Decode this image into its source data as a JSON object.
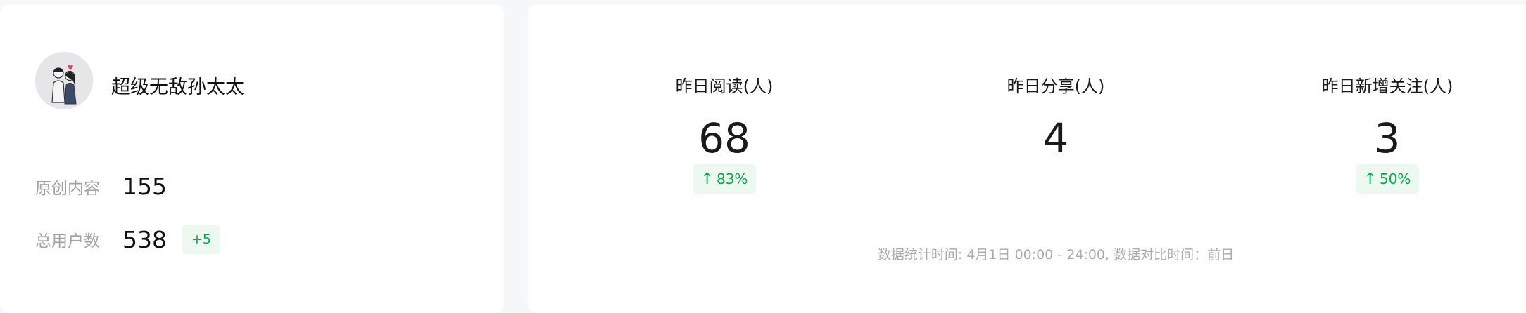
{
  "account": {
    "name": "超级无敌孙太太",
    "original_label": "原创内容",
    "original_value": "155",
    "users_label": "总用户数",
    "users_value": "538",
    "users_delta": "+5"
  },
  "metrics": [
    {
      "title": "昨日阅读(人)",
      "value": "68",
      "change_arrow": "↑",
      "change": "83%"
    },
    {
      "title": "昨日分享(人)",
      "value": "4"
    },
    {
      "title": "昨日新增关注(人)",
      "value": "3",
      "change_arrow": "↑",
      "change": "50%"
    }
  ],
  "footnote": "数据统计时间: 4月1日 00:00 - 24:00, 数据对比时间：前日",
  "colors": {
    "accent_green": "#07a84b",
    "badge_bg": "#edf8f1",
    "muted_text": "#a3a3a3"
  }
}
